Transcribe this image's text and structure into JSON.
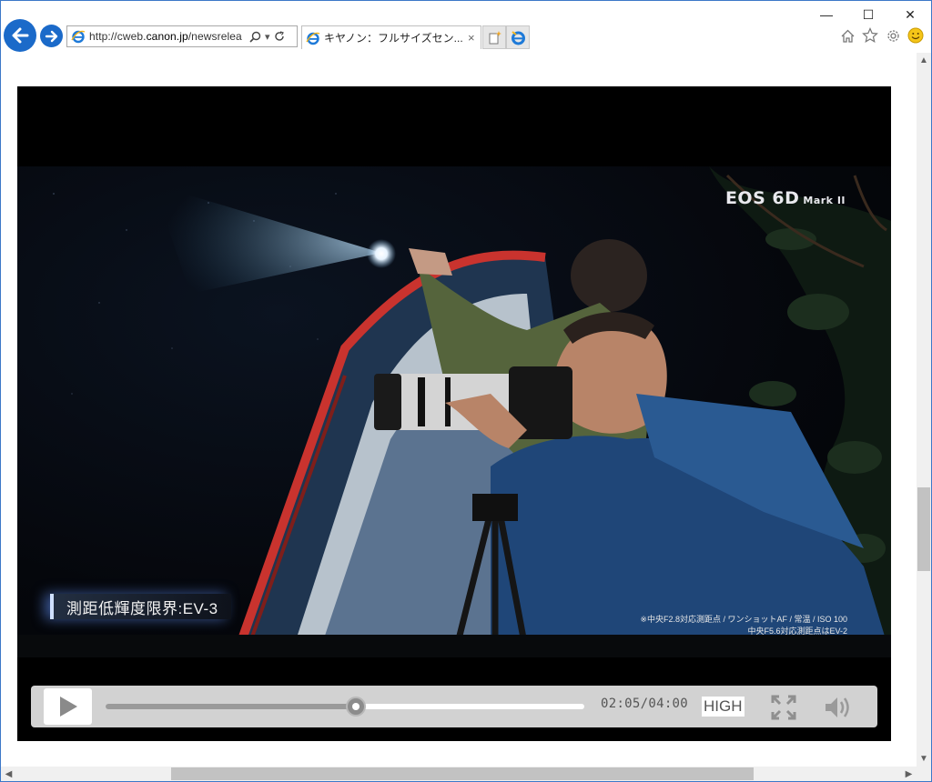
{
  "browser": {
    "url_prefix": "http://cweb.",
    "url_domain": "canon.jp",
    "url_rest": "/newsrelea",
    "tab_title": "キヤノン：フルサイズセン...",
    "tab_close": "×",
    "window_controls": {
      "minimize": "—",
      "maximize": "☐",
      "close": "✕"
    },
    "toolbar_icons": [
      "home-icon",
      "favorites-star-icon",
      "settings-gear-icon",
      "feedback-smiley-icon"
    ]
  },
  "video": {
    "brand_logo": "EOS 6D",
    "brand_logo_suffix": "Mark II",
    "caption": "測距低輝度限界:EV-3",
    "footnote_line1": "※中央F2.8対応測距点 / ワンショットAF / 常温 / ISO 100",
    "footnote_line2": "中央F5.6対応測距点はEV-2"
  },
  "player": {
    "time": "02:05/04:00",
    "quality": "HIGH",
    "progress": 0.523,
    "icons": {
      "play": "play-icon",
      "fullscreen": "fullscreen-icon",
      "volume": "volume-icon"
    }
  },
  "colors": {
    "accent": "#1b6ac9",
    "window_border": "#3c78c8",
    "controls_bg": "#d2d2d2",
    "progress_fill": "#9a9a9a"
  }
}
